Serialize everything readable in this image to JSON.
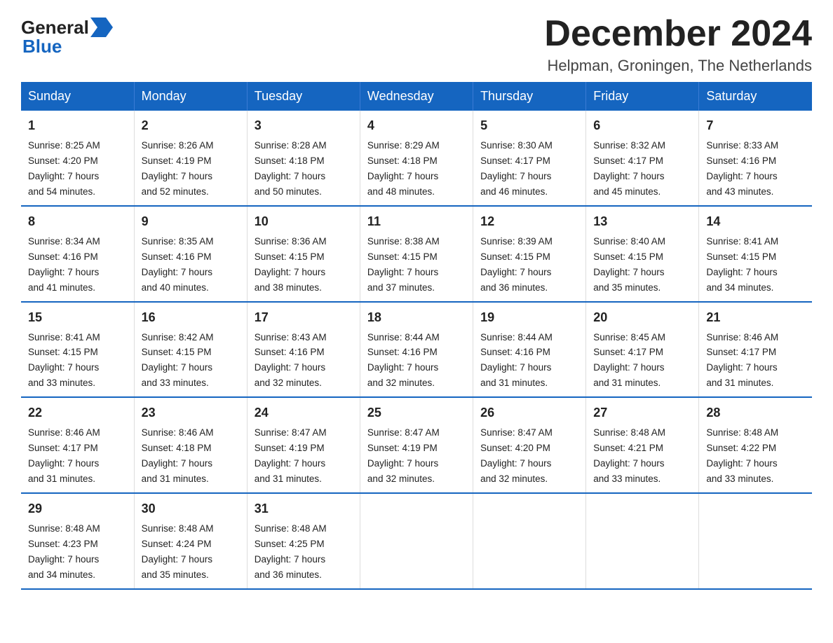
{
  "logo": {
    "general": "General",
    "blue": "Blue",
    "arrow": "▶"
  },
  "title": "December 2024",
  "subtitle": "Helpman, Groningen, The Netherlands",
  "days_of_week": [
    "Sunday",
    "Monday",
    "Tuesday",
    "Wednesday",
    "Thursday",
    "Friday",
    "Saturday"
  ],
  "weeks": [
    [
      {
        "day": "1",
        "sunrise": "8:25 AM",
        "sunset": "4:20 PM",
        "daylight": "7 hours and 54 minutes."
      },
      {
        "day": "2",
        "sunrise": "8:26 AM",
        "sunset": "4:19 PM",
        "daylight": "7 hours and 52 minutes."
      },
      {
        "day": "3",
        "sunrise": "8:28 AM",
        "sunset": "4:18 PM",
        "daylight": "7 hours and 50 minutes."
      },
      {
        "day": "4",
        "sunrise": "8:29 AM",
        "sunset": "4:18 PM",
        "daylight": "7 hours and 48 minutes."
      },
      {
        "day": "5",
        "sunrise": "8:30 AM",
        "sunset": "4:17 PM",
        "daylight": "7 hours and 46 minutes."
      },
      {
        "day": "6",
        "sunrise": "8:32 AM",
        "sunset": "4:17 PM",
        "daylight": "7 hours and 45 minutes."
      },
      {
        "day": "7",
        "sunrise": "8:33 AM",
        "sunset": "4:16 PM",
        "daylight": "7 hours and 43 minutes."
      }
    ],
    [
      {
        "day": "8",
        "sunrise": "8:34 AM",
        "sunset": "4:16 PM",
        "daylight": "7 hours and 41 minutes."
      },
      {
        "day": "9",
        "sunrise": "8:35 AM",
        "sunset": "4:16 PM",
        "daylight": "7 hours and 40 minutes."
      },
      {
        "day": "10",
        "sunrise": "8:36 AM",
        "sunset": "4:15 PM",
        "daylight": "7 hours and 38 minutes."
      },
      {
        "day": "11",
        "sunrise": "8:38 AM",
        "sunset": "4:15 PM",
        "daylight": "7 hours and 37 minutes."
      },
      {
        "day": "12",
        "sunrise": "8:39 AM",
        "sunset": "4:15 PM",
        "daylight": "7 hours and 36 minutes."
      },
      {
        "day": "13",
        "sunrise": "8:40 AM",
        "sunset": "4:15 PM",
        "daylight": "7 hours and 35 minutes."
      },
      {
        "day": "14",
        "sunrise": "8:41 AM",
        "sunset": "4:15 PM",
        "daylight": "7 hours and 34 minutes."
      }
    ],
    [
      {
        "day": "15",
        "sunrise": "8:41 AM",
        "sunset": "4:15 PM",
        "daylight": "7 hours and 33 minutes."
      },
      {
        "day": "16",
        "sunrise": "8:42 AM",
        "sunset": "4:15 PM",
        "daylight": "7 hours and 33 minutes."
      },
      {
        "day": "17",
        "sunrise": "8:43 AM",
        "sunset": "4:16 PM",
        "daylight": "7 hours and 32 minutes."
      },
      {
        "day": "18",
        "sunrise": "8:44 AM",
        "sunset": "4:16 PM",
        "daylight": "7 hours and 32 minutes."
      },
      {
        "day": "19",
        "sunrise": "8:44 AM",
        "sunset": "4:16 PM",
        "daylight": "7 hours and 31 minutes."
      },
      {
        "day": "20",
        "sunrise": "8:45 AM",
        "sunset": "4:17 PM",
        "daylight": "7 hours and 31 minutes."
      },
      {
        "day": "21",
        "sunrise": "8:46 AM",
        "sunset": "4:17 PM",
        "daylight": "7 hours and 31 minutes."
      }
    ],
    [
      {
        "day": "22",
        "sunrise": "8:46 AM",
        "sunset": "4:17 PM",
        "daylight": "7 hours and 31 minutes."
      },
      {
        "day": "23",
        "sunrise": "8:46 AM",
        "sunset": "4:18 PM",
        "daylight": "7 hours and 31 minutes."
      },
      {
        "day": "24",
        "sunrise": "8:47 AM",
        "sunset": "4:19 PM",
        "daylight": "7 hours and 31 minutes."
      },
      {
        "day": "25",
        "sunrise": "8:47 AM",
        "sunset": "4:19 PM",
        "daylight": "7 hours and 32 minutes."
      },
      {
        "day": "26",
        "sunrise": "8:47 AM",
        "sunset": "4:20 PM",
        "daylight": "7 hours and 32 minutes."
      },
      {
        "day": "27",
        "sunrise": "8:48 AM",
        "sunset": "4:21 PM",
        "daylight": "7 hours and 33 minutes."
      },
      {
        "day": "28",
        "sunrise": "8:48 AM",
        "sunset": "4:22 PM",
        "daylight": "7 hours and 33 minutes."
      }
    ],
    [
      {
        "day": "29",
        "sunrise": "8:48 AM",
        "sunset": "4:23 PM",
        "daylight": "7 hours and 34 minutes."
      },
      {
        "day": "30",
        "sunrise": "8:48 AM",
        "sunset": "4:24 PM",
        "daylight": "7 hours and 35 minutes."
      },
      {
        "day": "31",
        "sunrise": "8:48 AM",
        "sunset": "4:25 PM",
        "daylight": "7 hours and 36 minutes."
      },
      null,
      null,
      null,
      null
    ]
  ],
  "labels": {
    "sunrise": "Sunrise:",
    "sunset": "Sunset:",
    "daylight": "Daylight:"
  }
}
